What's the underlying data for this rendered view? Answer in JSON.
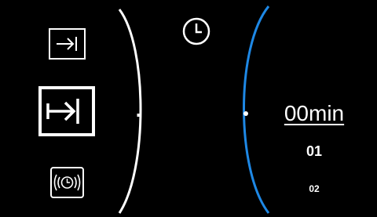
{
  "left_panel": {
    "items": [
      {
        "icon": "skip-to-end-icon",
        "selected": false
      },
      {
        "icon": "skip-to-end-icon",
        "selected": true
      },
      {
        "icon": "alarm-clock-icon",
        "selected": false
      }
    ]
  },
  "header": {
    "icon": "clock-icon"
  },
  "duration_picker": {
    "selected": "00min",
    "next": "01",
    "next2": "02",
    "accent_color": "#1e88e5"
  }
}
